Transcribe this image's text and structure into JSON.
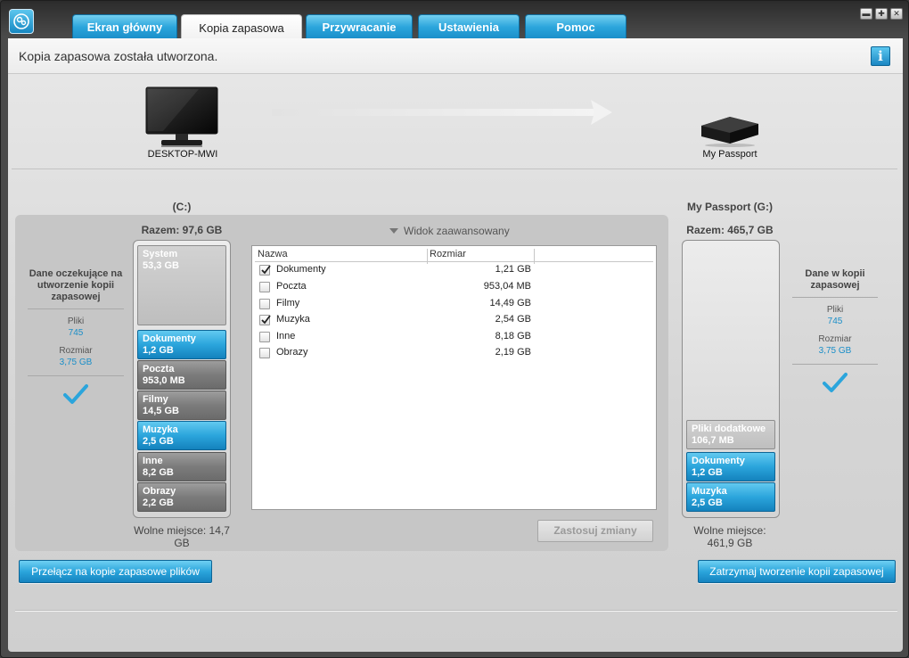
{
  "tabs": [
    {
      "label": "Ekran główny",
      "active": false
    },
    {
      "label": "Kopia zapasowa",
      "active": true
    },
    {
      "label": "Przywracanie",
      "active": false
    },
    {
      "label": "Ustawienia",
      "active": false
    },
    {
      "label": "Pomoc",
      "active": false
    }
  ],
  "window_controls": {
    "minimize": "▬",
    "maximize": "✚",
    "close": "✕"
  },
  "status": {
    "message": "Kopia zapasowa została utworzona.",
    "info_label": "i"
  },
  "source": {
    "computer_name": "DESKTOP-MWI",
    "drive_title": "(C:)",
    "total": "Razem: 97,6 GB",
    "free": "Wolne miejsce: 14,7 GB",
    "segments": [
      {
        "name": "System",
        "size": "53,3 GB",
        "style": "pale"
      },
      {
        "name": "Dokumenty",
        "size": "1,2 GB",
        "style": "blue"
      },
      {
        "name": "Poczta",
        "size": "953,0 MB",
        "style": "grey"
      },
      {
        "name": "Filmy",
        "size": "14,5 GB",
        "style": "grey"
      },
      {
        "name": "Muzyka",
        "size": "2,5 GB",
        "style": "blue"
      },
      {
        "name": "Inne",
        "size": "8,2 GB",
        "style": "grey"
      },
      {
        "name": "Obrazy",
        "size": "2,2 GB",
        "style": "grey"
      }
    ]
  },
  "pending": {
    "heading": "Dane oczekujące na utworzenie kopii zapasowej",
    "files_label": "Pliki",
    "files_value": "745",
    "size_label": "Rozmiar",
    "size_value": "3,75 GB",
    "status_icon": "checkmark-icon"
  },
  "advanced": {
    "toggle_label": "Widok zaawansowany",
    "columns": [
      "Nazwa",
      "Rozmiar"
    ],
    "rows": [
      {
        "name": "Dokumenty",
        "size": "1,21 GB",
        "checked": true
      },
      {
        "name": "Poczta",
        "size": "953,04 MB",
        "checked": false
      },
      {
        "name": "Filmy",
        "size": "14,49 GB",
        "checked": false
      },
      {
        "name": "Muzyka",
        "size": "2,54 GB",
        "checked": true
      },
      {
        "name": "Inne",
        "size": "8,18 GB",
        "checked": false
      },
      {
        "name": "Obrazy",
        "size": "2,19 GB",
        "checked": false
      }
    ],
    "apply_label": "Zastosuj zmiany"
  },
  "target": {
    "device_name": "My Passport",
    "drive_title": "My Passport (G:)",
    "total": "Razem: 465,7 GB",
    "free": "Wolne miejsce: 461,9 GB",
    "segments": [
      {
        "name": "Pliki dodatkowe",
        "size": "106,7 MB",
        "style": "pale"
      },
      {
        "name": "Dokumenty",
        "size": "1,2 GB",
        "style": "blue"
      },
      {
        "name": "Muzyka",
        "size": "2,5 GB",
        "style": "blue"
      }
    ]
  },
  "backed_up": {
    "heading": "Dane w kopii zapasowej",
    "files_label": "Pliki",
    "files_value": "745",
    "size_label": "Rozmiar",
    "size_value": "3,75 GB",
    "status_icon": "checkmark-icon"
  },
  "buttons": {
    "switch_label": "Przełącz na kopie zapasowe plików",
    "stop_label": "Zatrzymaj tworzenie kopii zapasowej"
  },
  "colors": {
    "accent": "#2ba5dc",
    "value_text": "#1a8ec8"
  }
}
